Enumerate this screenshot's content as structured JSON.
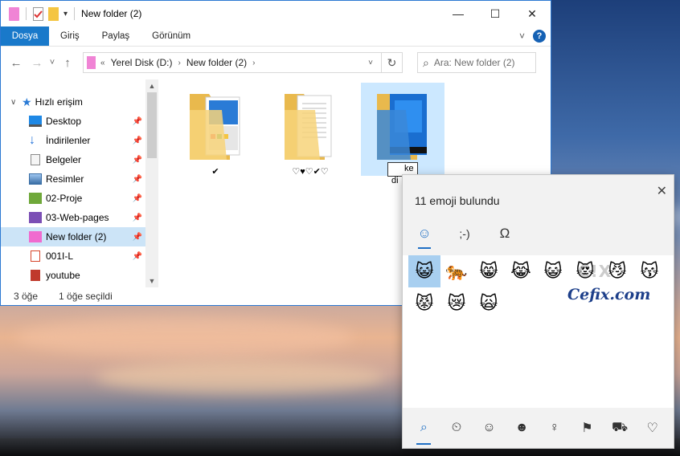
{
  "window": {
    "title": "New folder (2)",
    "minimize": "—",
    "maximize": "☐",
    "close": "✕"
  },
  "ribbon": {
    "tabs": [
      "Dosya",
      "Giriş",
      "Paylaş",
      "Görünüm"
    ],
    "collapse": "˅",
    "help": "?"
  },
  "nav": {
    "back": "←",
    "forward": "→",
    "recent": "˅",
    "up": "↑",
    "overflow": "«",
    "path": [
      "Yerel Disk (D:)",
      "New folder (2)"
    ],
    "path_chevron": "›",
    "dropdown": "˅",
    "refresh": "↻",
    "search_placeholder": "Ara: New folder (2)",
    "search_icon": "⌕"
  },
  "sidebar": {
    "header": "Hızlı erişim",
    "pin_glyph": "📌",
    "items": [
      {
        "label": "Desktop",
        "icon": "desktop-icon",
        "color": "#1e88e5"
      },
      {
        "label": "İndirilenler",
        "icon": "download-icon",
        "color": "#1e6fd9"
      },
      {
        "label": "Belgeler",
        "icon": "documents-icon",
        "color": "#8a8a8a"
      },
      {
        "label": "Resimler",
        "icon": "pictures-icon",
        "color": "#3a6ea5"
      },
      {
        "label": "02-Proje",
        "icon": "folder-icon",
        "color": "#6fa83a"
      },
      {
        "label": "03-Web-pages",
        "icon": "folder-icon",
        "color": "#7b4fb5"
      },
      {
        "label": "New folder (2)",
        "icon": "folder-icon",
        "color": "#f06bcf"
      },
      {
        "label": "001I-L",
        "icon": "file-icon",
        "color": "#d7452b"
      },
      {
        "label": "youtube",
        "icon": "folder-icon",
        "color": "#c0392b"
      }
    ],
    "scroll_up": "▲",
    "scroll_down": "▼"
  },
  "files": [
    {
      "label": "✔"
    },
    {
      "label": "♡♥♡✔♡"
    },
    {
      "label_visible": "ke",
      "label_rest": "di",
      "editing": true
    }
  ],
  "status": {
    "count": "3 öğe",
    "selected": "1 öğe seçildi"
  },
  "emoji_panel": {
    "close": "✕",
    "title": "11 emoji bulundu",
    "tabs": [
      "☺",
      ";-)",
      "Ω"
    ],
    "emojis": [
      "😺",
      "🐅",
      "😸",
      "😹",
      "😺",
      "😻",
      "😼",
      "😽",
      "😾",
      "😿",
      "🙀"
    ],
    "watermark": "Cefix.com",
    "watermark_logo": "C!X",
    "footer_icons": [
      "⌕",
      "⏲",
      "☺",
      "☻",
      "♀",
      "⚑",
      "⛟",
      "♡"
    ]
  },
  "colors": {
    "accent": "#1979ca",
    "selection": "#cce8ff"
  }
}
